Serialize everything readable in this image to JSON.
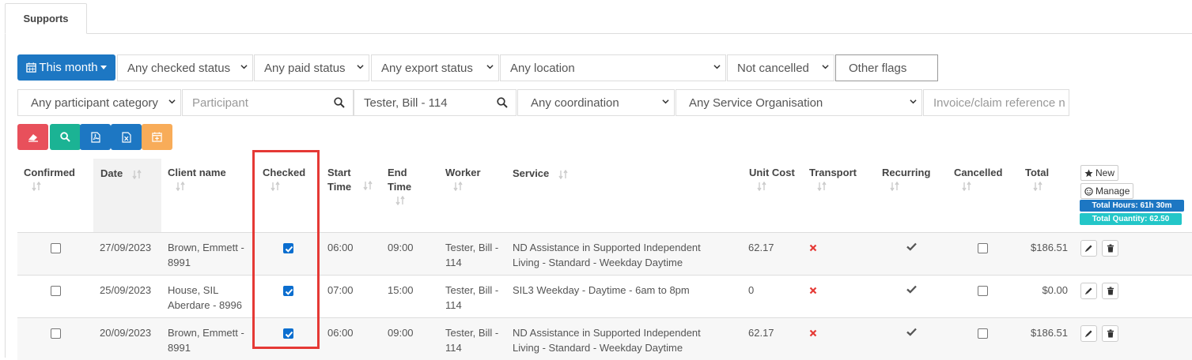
{
  "tabs": [
    {
      "label": "Supports"
    }
  ],
  "filters": {
    "date_button": "This month",
    "checked_status": "Any checked status",
    "paid_status": "Any paid status",
    "export_status": "Any export status",
    "location": "Any location",
    "cancelled": "Not cancelled",
    "other_flags": "Other flags",
    "participant_category": "Any participant category",
    "participant_placeholder": "Participant",
    "worker_value": "Tester, Bill - 114",
    "coordination": "Any coordination",
    "service_organisation": "Any Service Organisation",
    "invoice_placeholder": "Invoice/claim reference n"
  },
  "actions": {
    "colors": {
      "clear": "#e8505b",
      "search": "#1bb394",
      "pdf": "#1d77c3",
      "excel": "#1d77c3",
      "calendar": "#f8ac59"
    }
  },
  "table": {
    "headers": {
      "confirmed": "Confirmed",
      "date": "Date",
      "client": "Client name",
      "checked": "Checked",
      "start": "Start Time",
      "end": "End Time",
      "worker": "Worker",
      "service": "Service",
      "unit_cost": "Unit Cost",
      "transport": "Transport",
      "recurring": "Recurring",
      "cancelled": "Cancelled",
      "total": "Total"
    },
    "new_label": "New",
    "manage_label": "Manage",
    "total_hours": "Total Hours: 61h 30m",
    "total_quantity": "Total Quantity: 62.50",
    "rows": [
      {
        "confirmed": false,
        "date": "27/09/2023",
        "client": "Brown, Emmett - 8991",
        "checked": true,
        "start": "06:00",
        "end": "09:00",
        "worker": "Tester, Bill - 114",
        "service": "ND Assistance in Supported Independent Living - Standard - Weekday Daytime",
        "unit_cost": "62.17",
        "transport": false,
        "recurring": true,
        "cancelled": false,
        "total": "$186.51"
      },
      {
        "confirmed": false,
        "date": "25/09/2023",
        "client": "House, SIL Aberdare - 8996",
        "checked": true,
        "start": "07:00",
        "end": "15:00",
        "worker": "Tester, Bill - 114",
        "service": "SIL3 Weekday - Daytime - 6am to 8pm",
        "unit_cost": "0",
        "transport": false,
        "recurring": true,
        "cancelled": false,
        "total": "$0.00"
      },
      {
        "confirmed": false,
        "date": "20/09/2023",
        "client": "Brown, Emmett - 8991",
        "checked": true,
        "start": "06:00",
        "end": "09:00",
        "worker": "Tester, Bill - 114",
        "service": "ND Assistance in Supported Independent Living - Standard - Weekday Daytime",
        "unit_cost": "62.17",
        "transport": false,
        "recurring": true,
        "cancelled": false,
        "total": "$186.51"
      }
    ]
  }
}
